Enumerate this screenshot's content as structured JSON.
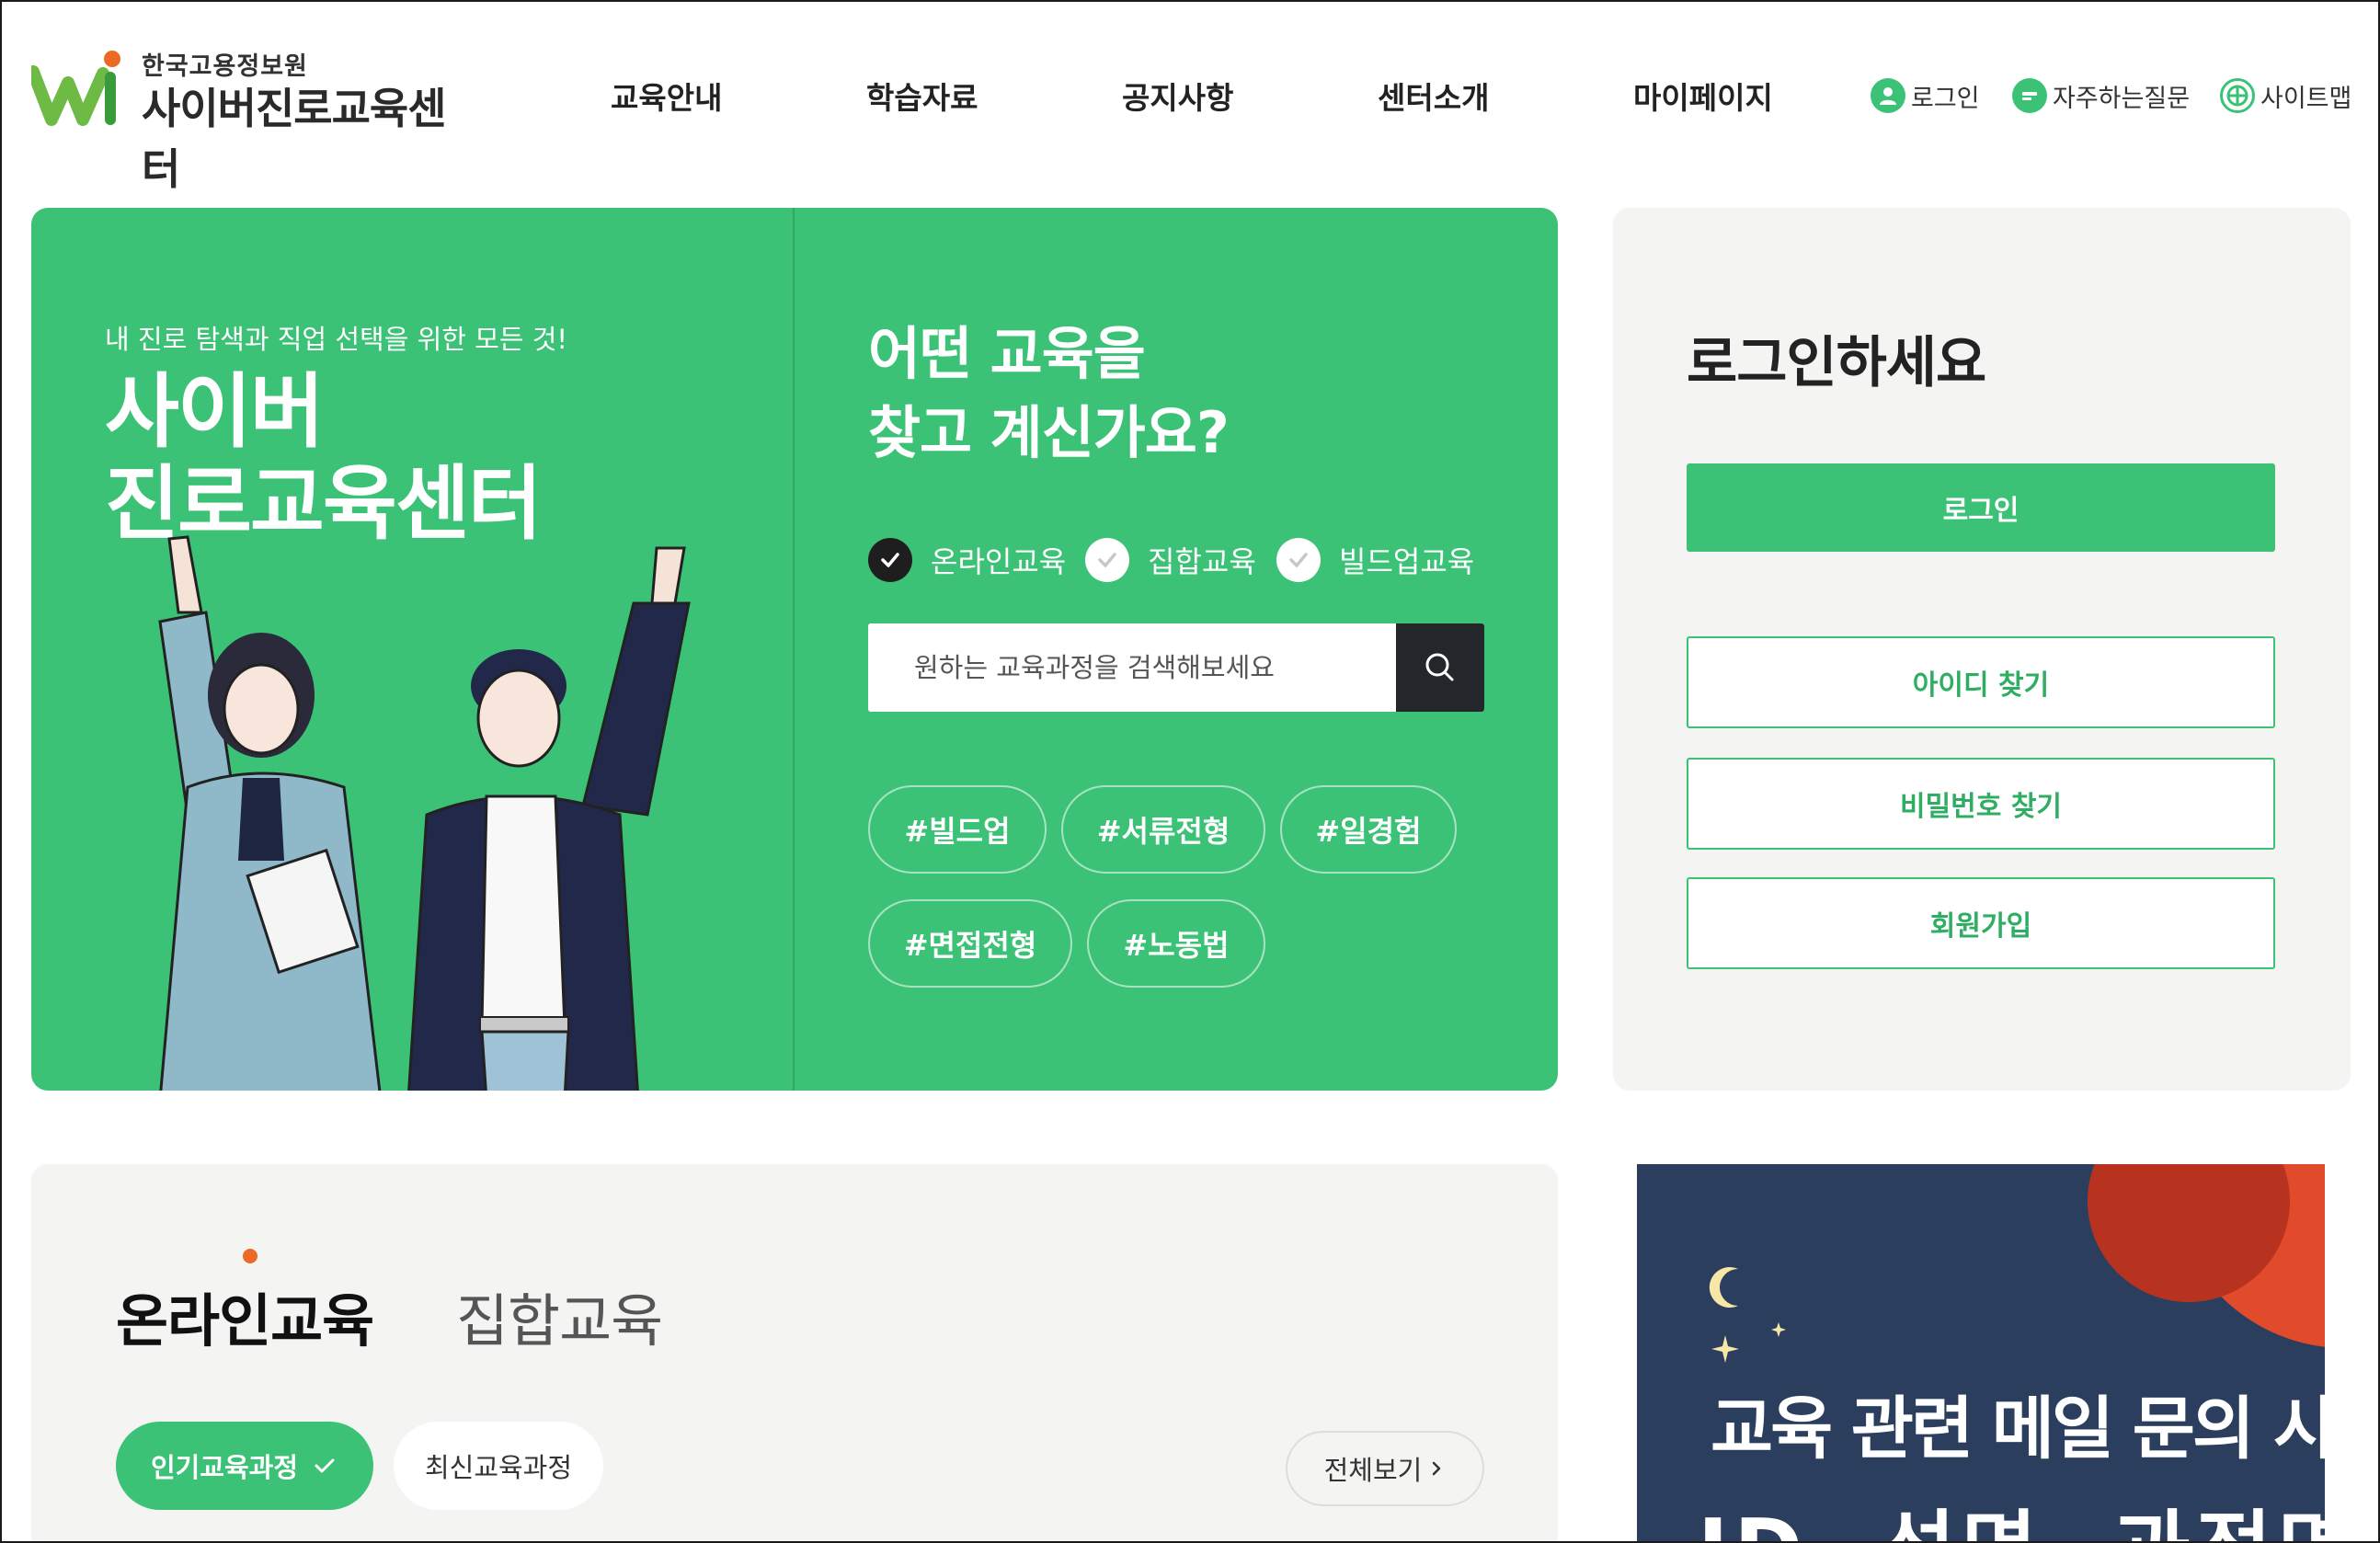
{
  "header": {
    "logo_sub": "한국고용정보원",
    "logo_main": "사이버진로교육센터",
    "nav": [
      "교육안내",
      "학습자료",
      "공지사항",
      "센터소개",
      "마이페이지"
    ],
    "util": {
      "login": "로그인",
      "faq": "자주하는질문",
      "sitemap": "사이트맵"
    }
  },
  "hero": {
    "tagline": "내 진로 탐색과 직업 선택을 위한 모든 것!",
    "title_line1": "사이버",
    "title_line2": "진로교육센터",
    "question_line1": "어떤 교육을",
    "question_line2": "찾고 계신가요?",
    "checks": [
      {
        "label": "온라인교육",
        "checked": true
      },
      {
        "label": "집합교육",
        "checked": false
      },
      {
        "label": "빌드업교육",
        "checked": false
      }
    ],
    "search_placeholder": "원하는 교육과정을 검색해보세요",
    "tags": [
      "#빌드업",
      "#서류전형",
      "#일경험",
      "#면접전형",
      "#노동법"
    ]
  },
  "login_panel": {
    "title": "로그인하세요",
    "login_button": "로그인",
    "find_id": "아이디 찾기",
    "find_pw": "비밀번호 찾기",
    "signup": "회원가입"
  },
  "courses": {
    "tabs": [
      "온라인교육",
      "집합교육"
    ],
    "active_tab": "온라인교육",
    "filters": [
      "인기교육과정",
      "최신교육과정"
    ],
    "active_filter": "인기교육과정",
    "more": "전체보기"
  },
  "banner": {
    "line1": "교육 관련 메일 문의 시",
    "line2": "ID, 성명, 과정명"
  },
  "colors": {
    "brand_green": "#3cc276",
    "dark": "#23272b",
    "accent_orange": "#ec6a26",
    "banner_navy": "#2c3e5e"
  }
}
